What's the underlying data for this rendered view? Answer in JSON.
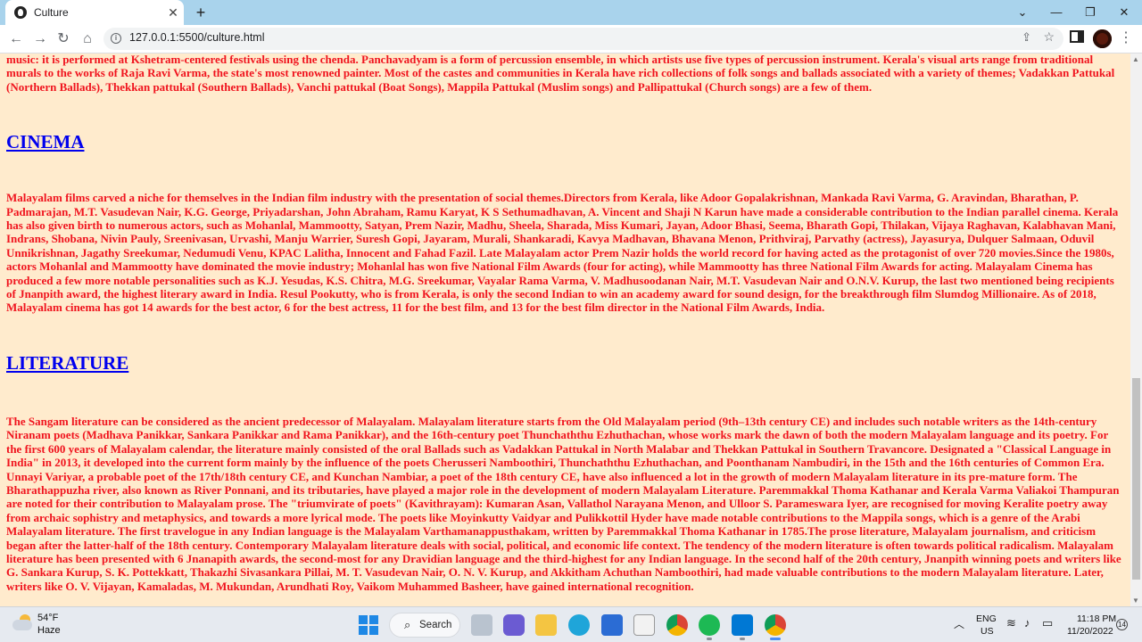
{
  "browser": {
    "tab_title": "Culture",
    "tab_close": "✕",
    "new_tab": "+",
    "url": "127.0.0.1:5500/culture.html",
    "window_controls": {
      "dropdown": "⌄",
      "minimize": "—",
      "maximize": "❐",
      "close": "✕"
    },
    "nav": {
      "back": "←",
      "forward": "→",
      "reload": "↻",
      "home": "⌂"
    },
    "menu": "⋮"
  },
  "page": {
    "background_color": "#ffebcd",
    "text_color": "#f0141e",
    "heading_color": "#0000ee",
    "intro_paragraph": "music: it is performed at Kshetram-centered festivals using the chenda. Panchavadyam is a form of percussion ensemble, in which artists use five types of percussion instrument. Kerala's visual arts range from traditional murals to the works of Raja Ravi Varma, the state's most renowned painter. Most of the castes and communities in Kerala have rich collections of folk songs and ballads associated with a variety of themes; Vadakkan Pattukal (Northern Ballads), Thekkan pattukal (Southern Ballads), Vanchi pattukal (Boat Songs), Mappila Pattukal (Muslim songs) and Pallipattukal (Church songs) are a few of them.",
    "cinema_heading": "CINEMA",
    "cinema_paragraph": "Malayalam films carved a niche for themselves in the Indian film industry with the presentation of social themes.Directors from Kerala, like Adoor Gopalakrishnan, Mankada Ravi Varma, G. Aravindan, Bharathan, P. Padmarajan, M.T. Vasudevan Nair, K.G. George, Priyadarshan, John Abraham, Ramu Karyat, K S Sethumadhavan, A. Vincent and Shaji N Karun have made a considerable contribution to the Indian parallel cinema. Kerala has also given birth to numerous actors, such as Mohanlal, Mammootty, Satyan, Prem Nazir, Madhu, Sheela, Sharada, Miss Kumari, Jayan, Adoor Bhasi, Seema, Bharath Gopi, Thilakan, Vijaya Raghavan, Kalabhavan Mani, Indrans, Shobana, Nivin Pauly, Sreenivasan, Urvashi, Manju Warrier, Suresh Gopi, Jayaram, Murali, Shankaradi, Kavya Madhavan, Bhavana Menon, Prithviraj, Parvathy (actress), Jayasurya, Dulquer Salmaan, Oduvil Unnikrishnan, Jagathy Sreekumar, Nedumudi Venu, KPAC Lalitha, Innocent and Fahad Fazil. Late Malayalam actor Prem Nazir holds the world record for having acted as the protagonist of over 720 movies.Since the 1980s, actors Mohanlal and Mammootty have dominated the movie industry; Mohanlal has won five National Film Awards (four for acting), while Mammootty has three National Film Awards for acting. Malayalam Cinema has produced a few more notable personalities such as K.J. Yesudas, K.S. Chitra, M.G. Sreekumar, Vayalar Rama Varma, V. Madhusoodanan Nair, M.T. Vasudevan Nair and O.N.V. Kurup, the last two mentioned being recipients of Jnanpith award, the highest literary award in India. Resul Pookutty, who is from Kerala, is only the second Indian to win an academy award for sound design, for the breakthrough film Slumdog Millionaire. As of 2018, Malayalam cinema has got 14 awards for the best actor, 6 for the best actress, 11 for the best film, and 13 for the best film director in the National Film Awards, India.",
    "literature_heading": "LITERATURE",
    "literature_paragraph": "The Sangam literature can be considered as the ancient predecessor of Malayalam. Malayalam literature starts from the Old Malayalam period (9th–13th century CE) and includes such notable writers as the 14th-century Niranam poets (Madhava Panikkar, Sankara Panikkar and Rama Panikkar), and the 16th-century poet Thunchaththu Ezhuthachan, whose works mark the dawn of both the modern Malayalam language and its poetry. For the first 600 years of Malayalam calendar, the literature mainly consisted of the oral Ballads such as Vadakkan Pattukal in North Malabar and Thekkan Pattukal in Southern Travancore. Designated a \"Classical Language in India\" in 2013, it developed into the current form mainly by the influence of the poets Cherusseri Namboothiri, Thunchaththu Ezhuthachan, and Poonthanam Nambudiri, in the 15th and the 16th centuries of Common Era. Unnayi Variyar, a probable poet of the 17th/18th century CE, and Kunchan Nambiar, a poet of the 18th century CE, have also influenced a lot in the growth of modern Malayalam literature in its pre-mature form. The Bharathappuzha river, also known as River Ponnani, and its tributaries, have played a major role in the development of modern Malayalam Literature. Paremmakkal Thoma Kathanar and Kerala Varma Valiakoi Thampuran are noted for their contribution to Malayalam prose. The \"triumvirate of poets\" (Kavithrayam): Kumaran Asan, Vallathol Narayana Menon, and Ulloor S. Parameswara Iyer, are recognised for moving Keralite poetry away from archaic sophistry and metaphysics, and towards a more lyrical mode. The poets like Moyinkutty Vaidyar and Pulikkottil Hyder have made notable contributions to the Mappila songs, which is a genre of the Arabi Malayalam literature. The first travelogue in any Indian language is the Malayalam Varthamanappusthakam, written by Paremmakkal Thoma Kathanar in 1785.The prose literature, Malayalam journalism, and criticism began after the latter-half of the 18th century. Contemporary Malayalam literature deals with social, political, and economic life context. The tendency of the modern literature is often towards political radicalism. Malayalam literature has been presented with 6 Jnanapith awards, the second-most for any Dravidian language and the third-highest for any Indian language. In the second half of the 20th century, Jnanpith winning poets and writers like G. Sankara Kurup, S. K. Pottekkatt, Thakazhi Sivasankara Pillai, M. T. Vasudevan Nair, O. N. V. Kurup, and Akkitham Achuthan Namboothiri, had made valuable contributions to the modern Malayalam literature. Later, writers like O. V. Vijayan, Kamaladas, M. Mukundan, Arundhati Roy, Vaikom Muhammed Basheer, have gained international recognition."
  },
  "taskbar": {
    "weather_temp": "54°F",
    "weather_condition": "Haze",
    "search_label": "Search",
    "language_line1": "ENG",
    "language_line2": "US",
    "time": "11:18 PM",
    "date": "11/20/2022",
    "notification_count": "14",
    "apps": [
      "start",
      "search",
      "file-manager",
      "teams-chat",
      "file-explorer",
      "edge",
      "store",
      "notepad",
      "chrome",
      "spotify",
      "vscode",
      "chrome-active"
    ]
  }
}
